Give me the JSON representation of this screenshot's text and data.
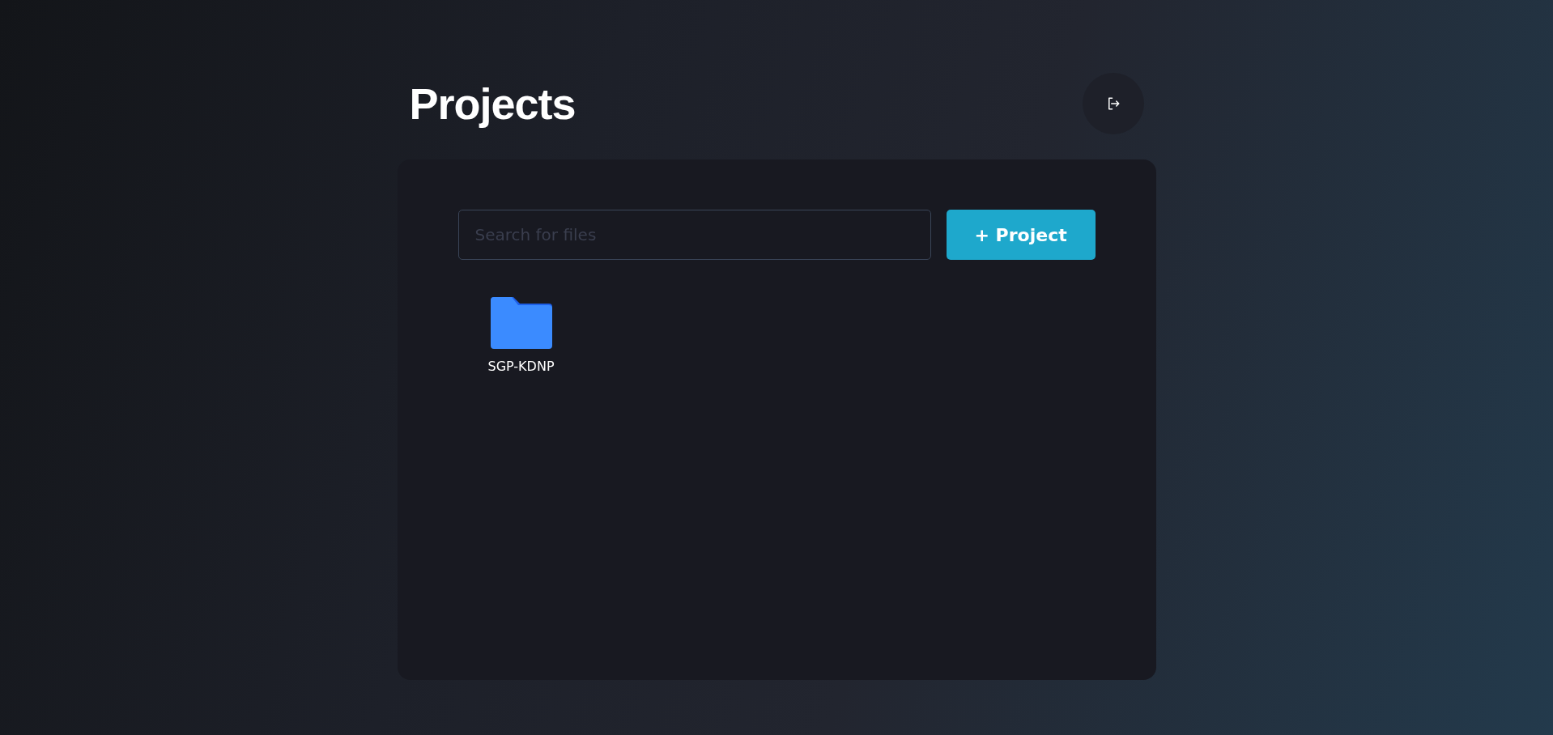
{
  "header": {
    "title": "Projects"
  },
  "search": {
    "placeholder": "Search for files"
  },
  "add_button": {
    "label": "+ Project"
  },
  "projects": [
    {
      "name": "SGP-KDNP"
    }
  ]
}
